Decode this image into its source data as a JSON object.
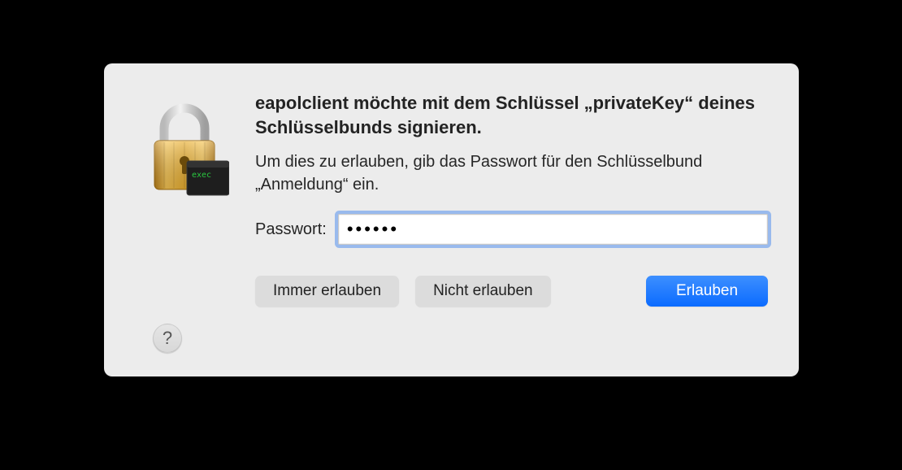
{
  "dialog": {
    "title": "eapolclient möchte mit dem Schlüssel „privateKey“ deines Schlüsselbunds signieren.",
    "subtitle": "Um dies zu erlauben, gib das Passwort für den Schlüsselbund „Anmeldung“ ein.",
    "password_label": "Passwort:",
    "password_value": "••••••",
    "buttons": {
      "always_allow": "Immer erlauben",
      "deny": "Nicht erlauben",
      "allow": "Erlauben"
    },
    "help_label": "?",
    "exec_badge": "exec"
  }
}
